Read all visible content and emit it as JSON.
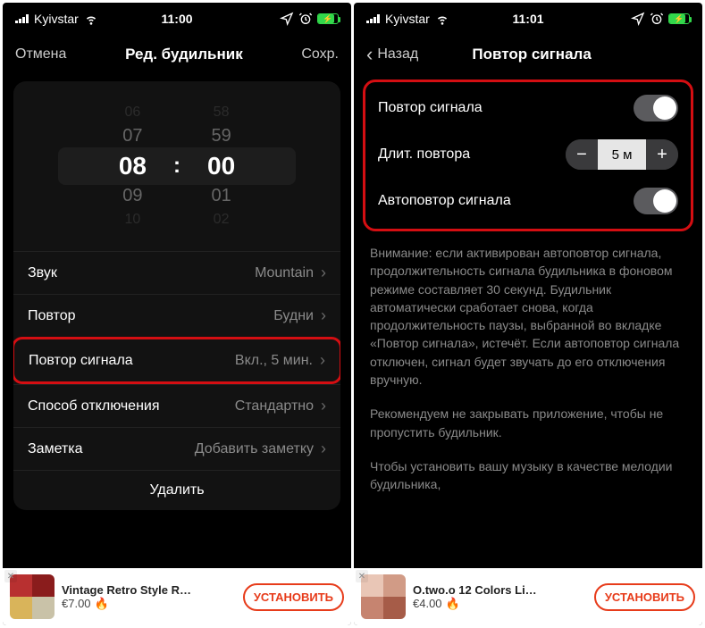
{
  "left": {
    "status": {
      "carrier": "Kyivstar",
      "time": "11:00"
    },
    "nav": {
      "cancel": "Отмена",
      "title": "Ред. будильник",
      "save": "Сохр."
    },
    "picker": {
      "hours": [
        "06",
        "07",
        "08",
        "09",
        "10"
      ],
      "mins": [
        "58",
        "59",
        "00",
        "01",
        "02"
      ]
    },
    "rows": {
      "sound": {
        "label": "Звук",
        "value": "Mountain"
      },
      "repeat": {
        "label": "Повтор",
        "value": "Будни"
      },
      "snooze": {
        "label": "Повтор сигнала",
        "value": "Вкл., 5 мин."
      },
      "dismiss": {
        "label": "Способ отключения",
        "value": "Стандартно"
      },
      "note": {
        "label": "Заметка",
        "placeholder": "Добавить заметку"
      }
    },
    "delete": "Удалить",
    "ad": {
      "title": "Vintage Retro Style R…",
      "price": "€7.00",
      "cta": "УСТАНОВИТЬ"
    }
  },
  "right": {
    "status": {
      "carrier": "Kyivstar",
      "time": "11:01"
    },
    "nav": {
      "back": "Назад",
      "title": "Повтор сигнала"
    },
    "settings": {
      "snooze": {
        "label": "Повтор сигнала",
        "on": true
      },
      "duration": {
        "label": "Длит. повтора",
        "value": "5 м"
      },
      "auto": {
        "label": "Автоповтор сигнала",
        "on": true
      }
    },
    "info": {
      "p1": "Внимание: если активирован автоповтор сигнала, продолжительность сигнала будильника в фоновом режиме составляет 30 секунд. Будильник автоматически сработает снова, когда продолжительность паузы, выбранной во вкладке «Повтор сигнала», истечёт. Если автоповтор сигнала отключен, сигнал будет звучать до его отключения вручную.",
      "p2": "Рекомендуем не закрывать приложение, чтобы не пропустить будильник.",
      "p3": "Чтобы установить вашу музыку в качестве мелодии будильника,"
    },
    "ad": {
      "title": "O.two.o 12 Colors Li…",
      "price": "€4.00",
      "cta": "УСТАНОВИТЬ"
    }
  }
}
